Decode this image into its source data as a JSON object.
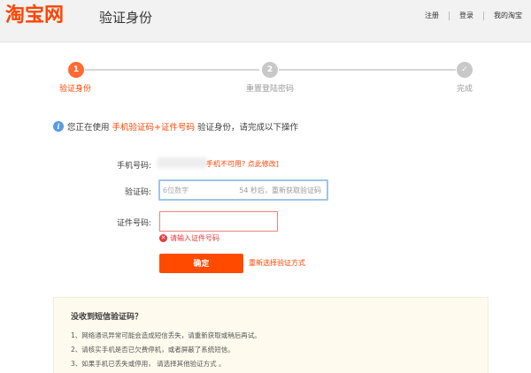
{
  "header": {
    "logo_text": "淘宝网",
    "title": "验证身份",
    "links": [
      "注册",
      "登录",
      "我的淘宝"
    ]
  },
  "steps": [
    {
      "number": "1",
      "label": "验证身份",
      "state": "active"
    },
    {
      "number": "2",
      "label": "重置登陆密码",
      "state": "pending"
    },
    {
      "number": "✓",
      "label": "完成",
      "state": "pending"
    }
  ],
  "notice": {
    "icon": "info-icon",
    "prefix": "您正在使用",
    "highlight": "手机验证码+证件号码",
    "suffix": "验证身份，请完成以下操作"
  },
  "form": {
    "phone_label": "手机号码:",
    "phone_link": "手机不可用? 点此修改]",
    "code_label": "验证码:",
    "code_placeholder": "6位数字",
    "code_value": "",
    "resend_text": "54 秒后，重新获取验证码",
    "id_label": "证件号码:",
    "id_value": "",
    "error_text": "请输入证件号码",
    "confirm_label": "确定",
    "reselect_link": "重新选择验证方式"
  },
  "help": {
    "title": "没收到短信验证码？",
    "items": [
      "1、网络通讯异常可能会造成短信丢失，请重新获取或稍后再试。",
      "2、请核实手机是否已欠费停机，或者屏蔽了系统短信。",
      "3、如果手机已丢失或停用，  请选择其他验证方式 。"
    ]
  },
  "colors": {
    "brand": "#ff4400",
    "button": "#ff4a00",
    "active_step": "#ff6a33",
    "pending_step": "#c8c8c8",
    "error": "#e4393c",
    "info": "#5a9ce0"
  }
}
